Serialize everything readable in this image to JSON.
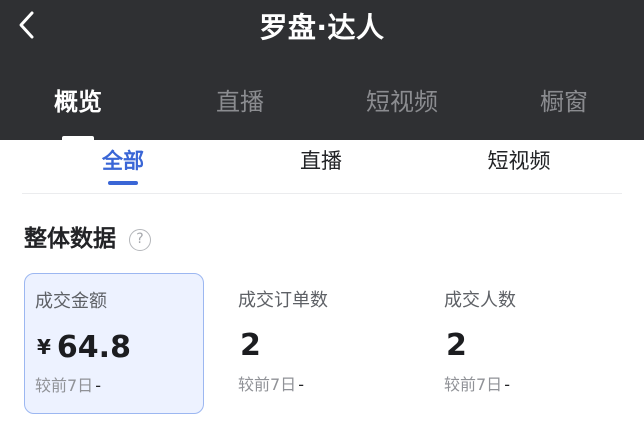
{
  "header": {
    "title": "罗盘·达人",
    "back_icon": "chevron-left-icon"
  },
  "main_tabs": [
    {
      "label": "概览",
      "active": true
    },
    {
      "label": "直播",
      "active": false
    },
    {
      "label": "短视频",
      "active": false
    },
    {
      "label": "橱窗",
      "active": false
    }
  ],
  "sub_tabs": [
    {
      "label": "全部",
      "active": true
    },
    {
      "label": "直播",
      "active": false
    },
    {
      "label": "短视频",
      "active": false
    }
  ],
  "section": {
    "title": "整体数据",
    "help_icon": "question-circle-icon",
    "help_glyph": "?"
  },
  "metrics": [
    {
      "label": "成交金额",
      "currency": "¥",
      "value": "64.8",
      "compare_label": "较前7日",
      "compare_value": "-",
      "selected": true
    },
    {
      "label": "成交订单数",
      "currency": "",
      "value": "2",
      "compare_label": "较前7日",
      "compare_value": "-",
      "selected": false
    },
    {
      "label": "成交人数",
      "currency": "",
      "value": "2",
      "compare_label": "较前7日",
      "compare_value": "-",
      "selected": false
    }
  ],
  "colors": {
    "header_bg": "#2f3033",
    "accent": "#3a66d6",
    "selected_card_bg": "#edf2ff",
    "selected_card_border": "#9cb7f1"
  }
}
